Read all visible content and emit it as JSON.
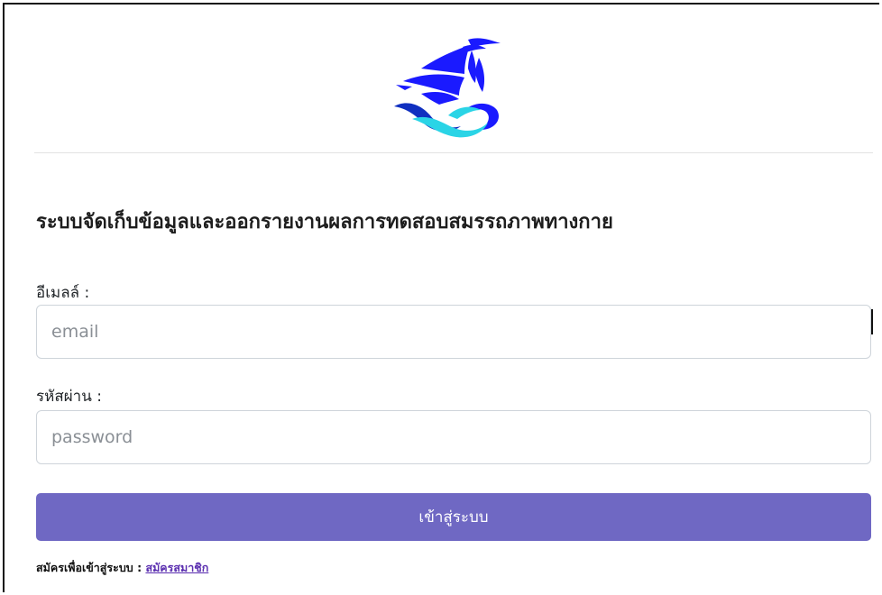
{
  "page": {
    "title": "ระบบจัดเก็บข้อมูลและออกรายงานผลการทดสอบสมรรถภาพทางกาย"
  },
  "logo": {
    "icon": "ship-on-wave-logo",
    "colors": {
      "primary": "#1a1aff",
      "wave_dark": "#1030c0",
      "wave_light": "#2ad4e6"
    }
  },
  "form": {
    "email": {
      "label": "อีเมลล์ :",
      "placeholder": "email",
      "value": ""
    },
    "password": {
      "label": "รหัสผ่าน :",
      "placeholder": "password",
      "value": ""
    },
    "submit_label": "เข้าสู่ระบบ"
  },
  "register": {
    "prompt": "สมัครเพื่อเข้าสู่ระบบ :",
    "link_label": "สมัครสมาชิก"
  },
  "colors": {
    "button": "#6f68c3",
    "link": "#5b2fb0",
    "input_border": "#ced4da"
  }
}
